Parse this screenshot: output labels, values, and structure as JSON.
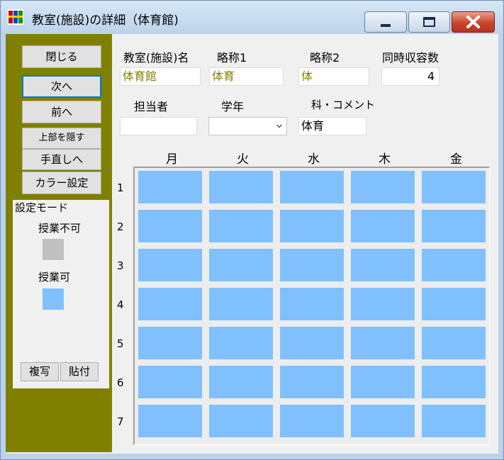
{
  "window": {
    "title": "教室(施設)の詳細（体育館)"
  },
  "left_panel": {
    "buttons": {
      "close": "閉じる",
      "next": "次へ",
      "prev": "前へ",
      "hide_top": "上部を隠す",
      "redo": "手直しへ",
      "color_settings": "カラー設定"
    },
    "mode": {
      "legend": "設定モード",
      "unavailable_label": "授業不可",
      "available_label": "授業可",
      "unavailable_color": "#c0c0c0",
      "available_color": "#80c0ff",
      "copy": "複写",
      "paste": "貼付"
    },
    "panel_color": "#808000"
  },
  "form": {
    "room_name_label": "教室(施設)名",
    "abbr1_label": "略称1",
    "abbr2_label": "略称2",
    "capacity_label": "同時収容数",
    "room_name_value": "体育館",
    "abbr1_value": "体育",
    "abbr2_value": "体",
    "capacity_value": "4",
    "teacher_label": "担当者",
    "grade_label": "学年",
    "subject_label": "科・コメント",
    "teacher_value": "",
    "grade_value": "",
    "subject_value": "体育",
    "value_color": "#808000"
  },
  "timetable": {
    "days": [
      "月",
      "火",
      "水",
      "木",
      "金"
    ],
    "periods": [
      "1",
      "2",
      "3",
      "4",
      "5",
      "6",
      "7"
    ],
    "cell_state": "授業可"
  }
}
